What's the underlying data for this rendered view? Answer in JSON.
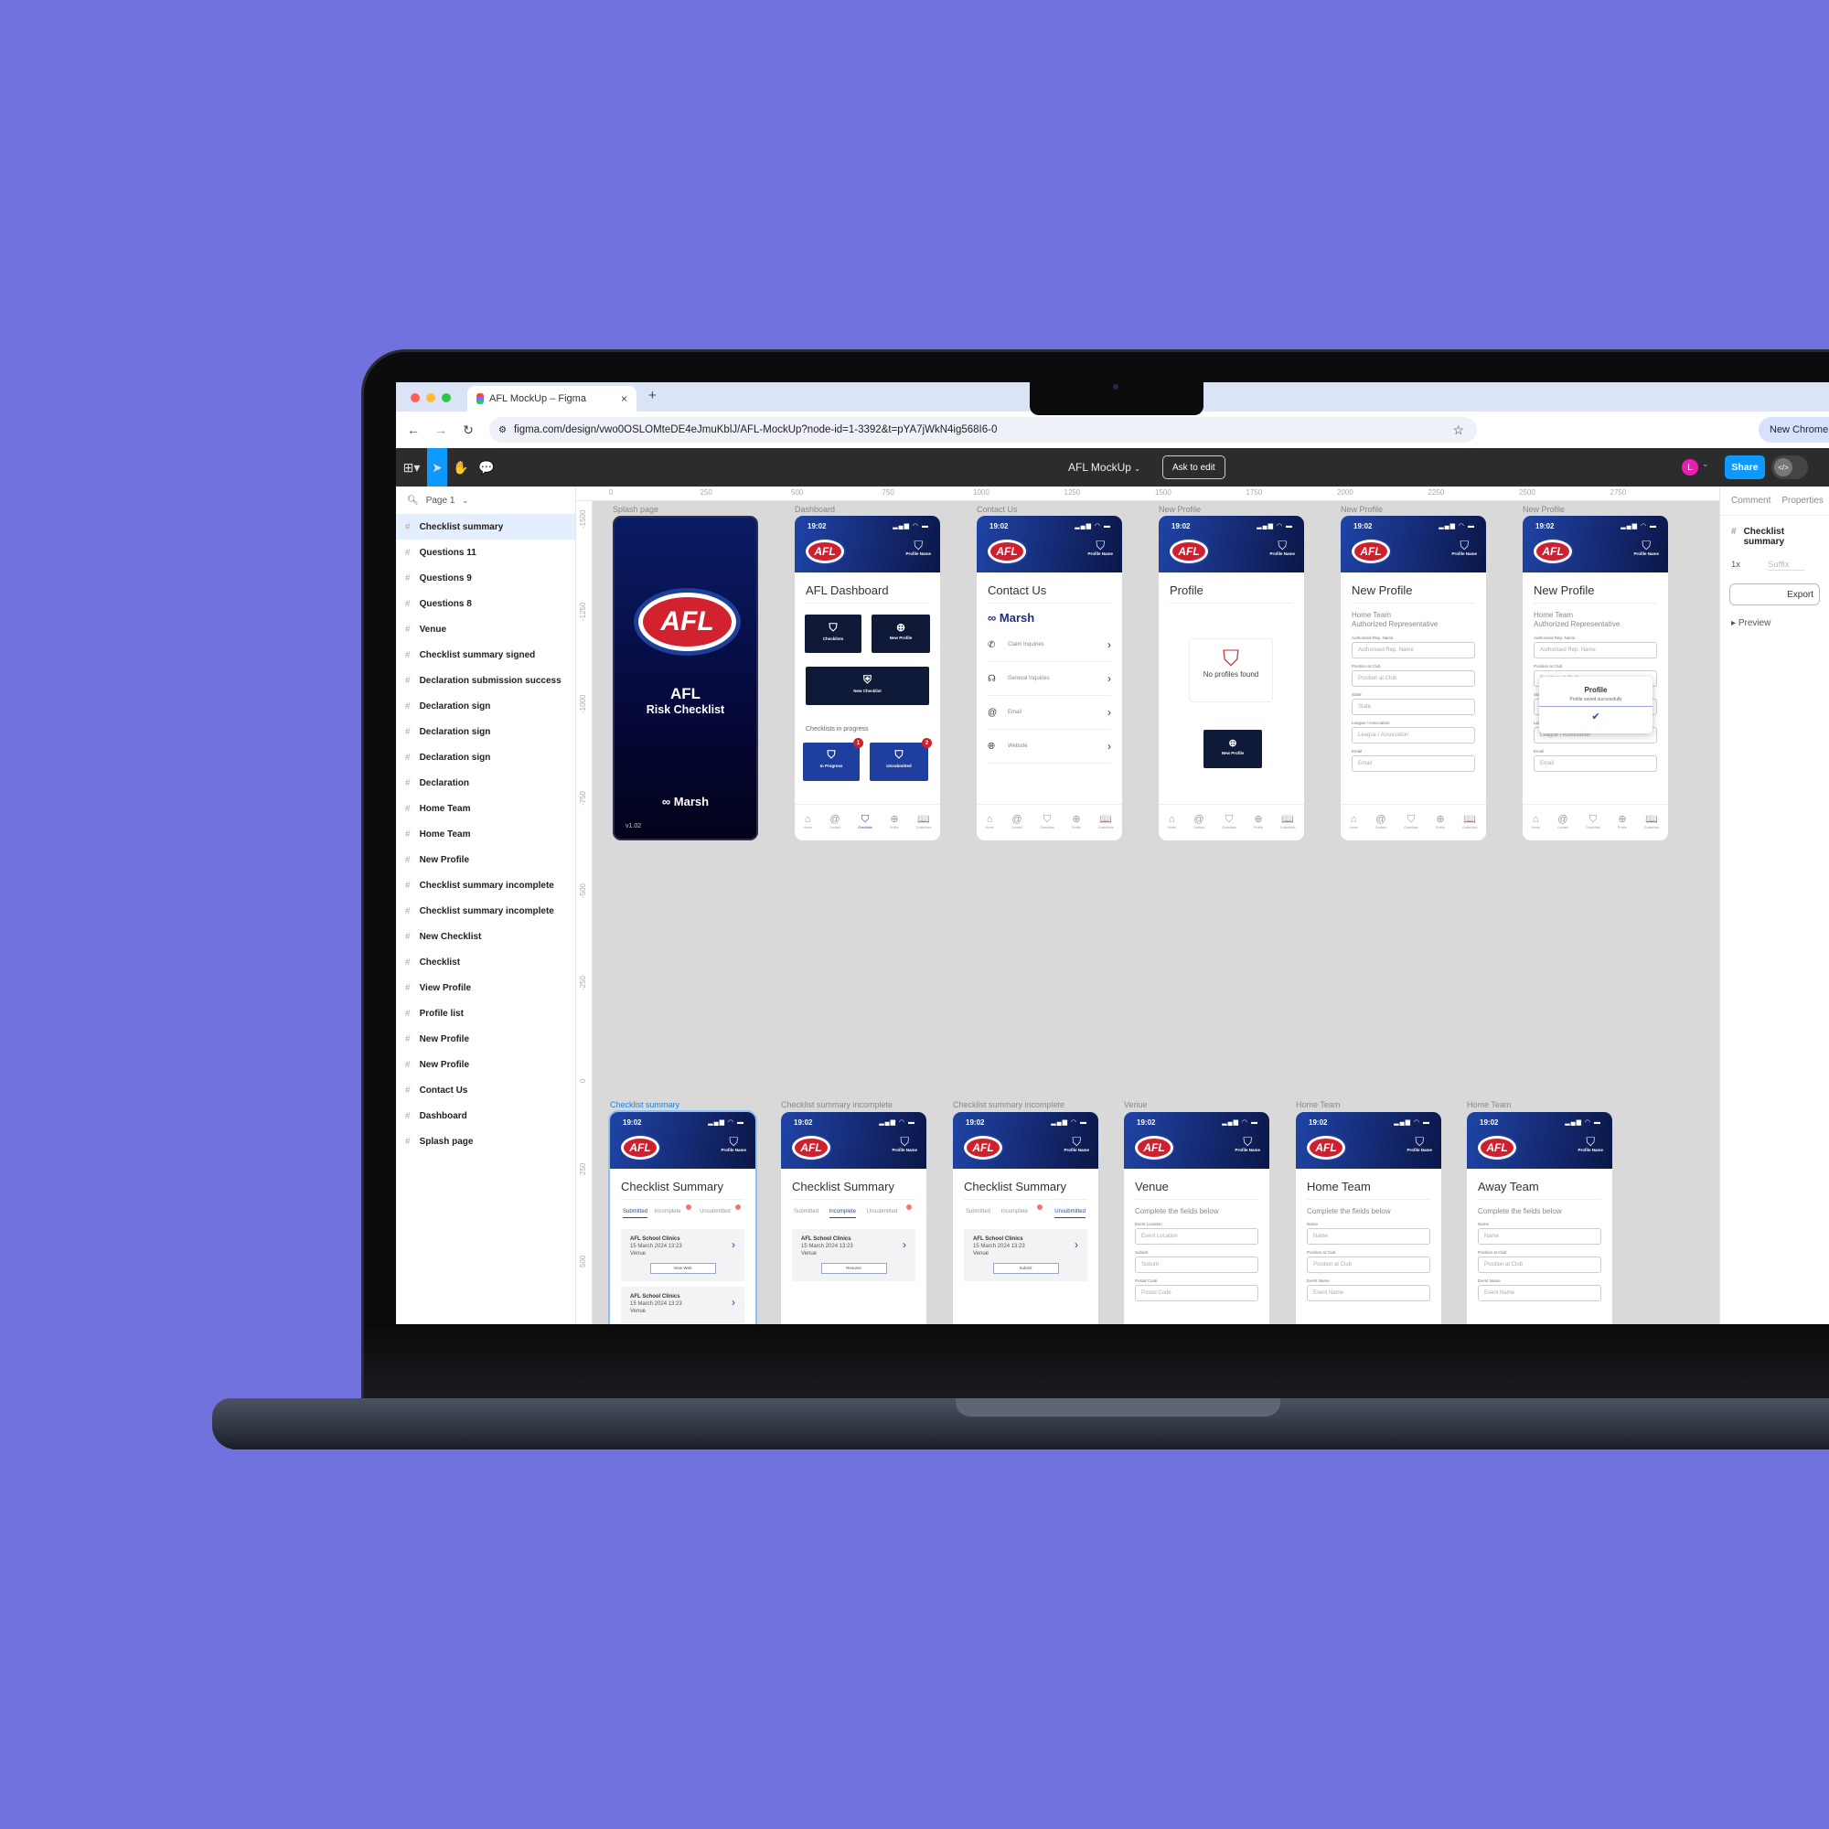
{
  "browser": {
    "tab_title": "AFL MockUp – Figma",
    "url": "figma.com/design/vwo0OSLOMteDE4eJmuKblJ/AFL-MockUp?node-id=1-3392&t=pYA7jWkN4ig568I6-0",
    "new_chrome_label": "New Chrome",
    "new_tab_symbol": "+",
    "close_symbol": "×"
  },
  "figma_toolbar": {
    "file_title": "AFL MockUp",
    "ask_to_edit": "Ask to edit",
    "avatar_initial": "L",
    "share_label": "Share",
    "dev_mode_label": "</>"
  },
  "layers_panel": {
    "page_name": "Page 1",
    "layers": [
      {
        "label": "Checklist summary",
        "active": true
      },
      {
        "label": "Questions 11"
      },
      {
        "label": "Questions 9"
      },
      {
        "label": "Questions 8"
      },
      {
        "label": "Venue"
      },
      {
        "label": "Checklist summary signed"
      },
      {
        "label": "Declaration submission success"
      },
      {
        "label": "Declaration sign"
      },
      {
        "label": "Declaration sign"
      },
      {
        "label": "Declaration sign"
      },
      {
        "label": "Declaration"
      },
      {
        "label": "Home Team"
      },
      {
        "label": "Home Team"
      },
      {
        "label": "New Profile"
      },
      {
        "label": "Checklist summary incomplete"
      },
      {
        "label": "Checklist summary incomplete"
      },
      {
        "label": "New Checklist"
      },
      {
        "label": "Checklist"
      },
      {
        "label": "View Profile"
      },
      {
        "label": "Profile list"
      },
      {
        "label": "New Profile"
      },
      {
        "label": "New Profile"
      },
      {
        "label": "Contact Us"
      },
      {
        "label": "Dashboard"
      },
      {
        "label": "Splash page"
      }
    ]
  },
  "rulers": {
    "horizontal": [
      "0",
      "250",
      "500",
      "750",
      "1000",
      "1250",
      "1500",
      "1750",
      "2000",
      "2250",
      "2500",
      "2750"
    ],
    "vertical": [
      "-1500",
      "-1250",
      "-1000",
      "-750",
      "-500",
      "-250",
      "0",
      "250",
      "500"
    ]
  },
  "right_panel": {
    "tabs": [
      "Comment",
      "Properties"
    ],
    "selection_name": "Checklist summary",
    "scale": "1x",
    "suffix_placeholder": "Suffix",
    "export_label": "Export",
    "preview_label": "Preview"
  },
  "app_common": {
    "status_time": "19:02",
    "status_icons": "▂▄▆ ◠ ▬",
    "afl_logo": "AFL",
    "profile_name": "Profile Name",
    "nav": [
      {
        "label": "Home",
        "icon": "⌂"
      },
      {
        "label": "Contact",
        "icon": "@"
      },
      {
        "label": "Checklists",
        "icon": "⛉"
      },
      {
        "label": "Profile",
        "icon": "⊕"
      },
      {
        "label": "Guidelines",
        "icon": "📖"
      }
    ]
  },
  "frames": {
    "splash": {
      "label": "Splash page",
      "title": "AFL",
      "subtitle": "Risk Checklist",
      "brand": "∞ Marsh",
      "version": "v1.02"
    },
    "dashboard": {
      "label": "Dashboard",
      "title": "AFL Dashboard",
      "buttons": [
        "Checklists",
        "New Profile",
        "New Checklist"
      ],
      "section": "Checklists in progress",
      "progress_cards": [
        {
          "label": "In Progress",
          "count": "1"
        },
        {
          "label": "Unsubmitted",
          "count": "2"
        }
      ]
    },
    "contact": {
      "label": "Contact Us",
      "title": "Contact Us",
      "brand": "∞ Marsh",
      "rows": [
        "Claim Inquiries",
        "General Inquiries",
        "Email",
        "Website"
      ]
    },
    "profile_empty": {
      "label": "New Profile",
      "title": "Profile",
      "empty_text": "No profiles found",
      "button": "New Profile"
    },
    "new_profile": {
      "label": "New Profile",
      "title": "New Profile",
      "subtitle_1": "Home Team",
      "subtitle_2": "Authorized Representative",
      "fields": [
        {
          "label": "Authorised Rep. Name",
          "placeholder": "Authorised Rep. Name"
        },
        {
          "label": "Position at Club",
          "placeholder": "Position at Club"
        },
        {
          "label": "State",
          "placeholder": "State"
        },
        {
          "label": "League / Association",
          "placeholder": "League / Association"
        },
        {
          "label": "Email",
          "placeholder": "Email"
        }
      ]
    },
    "new_profile_saved": {
      "label": "New Profile",
      "toast_title": "Profile",
      "toast_message": "Profile saved successfully"
    },
    "checklist_summary": [
      {
        "label": "Checklist summary",
        "title": "Checklist Summary",
        "active_tab": 0,
        "button": "View Web",
        "cards": 2
      },
      {
        "label": "Checklist summary incomplete",
        "title": "Checklist Summary",
        "active_tab": 1,
        "button": "Resume",
        "cards": 1
      },
      {
        "label": "Checklist summary incomplete",
        "title": "Checklist Summary",
        "active_tab": 2,
        "button": "Submit",
        "cards": 1
      }
    ],
    "summary_tabs": [
      "Submitted",
      "Incomplete",
      "Unsubmitted"
    ],
    "summary_card": {
      "name": "AFL School Clinics",
      "datetime": "15 March 2024 13:23",
      "place": "Venue"
    },
    "venue": {
      "label": "Venue",
      "title": "Venue",
      "subtitle": "Complete the fields below",
      "fields": [
        "Event Location",
        "Suburb",
        "Postal Code"
      ]
    },
    "home_team": {
      "label": "Home Team",
      "title": "Home Team",
      "subtitle": "Complete the fields below",
      "fields": [
        "Name",
        "Position at Club",
        "Event Name"
      ]
    },
    "away_team": {
      "label": "Home Team",
      "title": "Away Team",
      "subtitle": "Complete the fields below",
      "fields": [
        "Name",
        "Position at Club",
        "Event Name"
      ]
    }
  }
}
